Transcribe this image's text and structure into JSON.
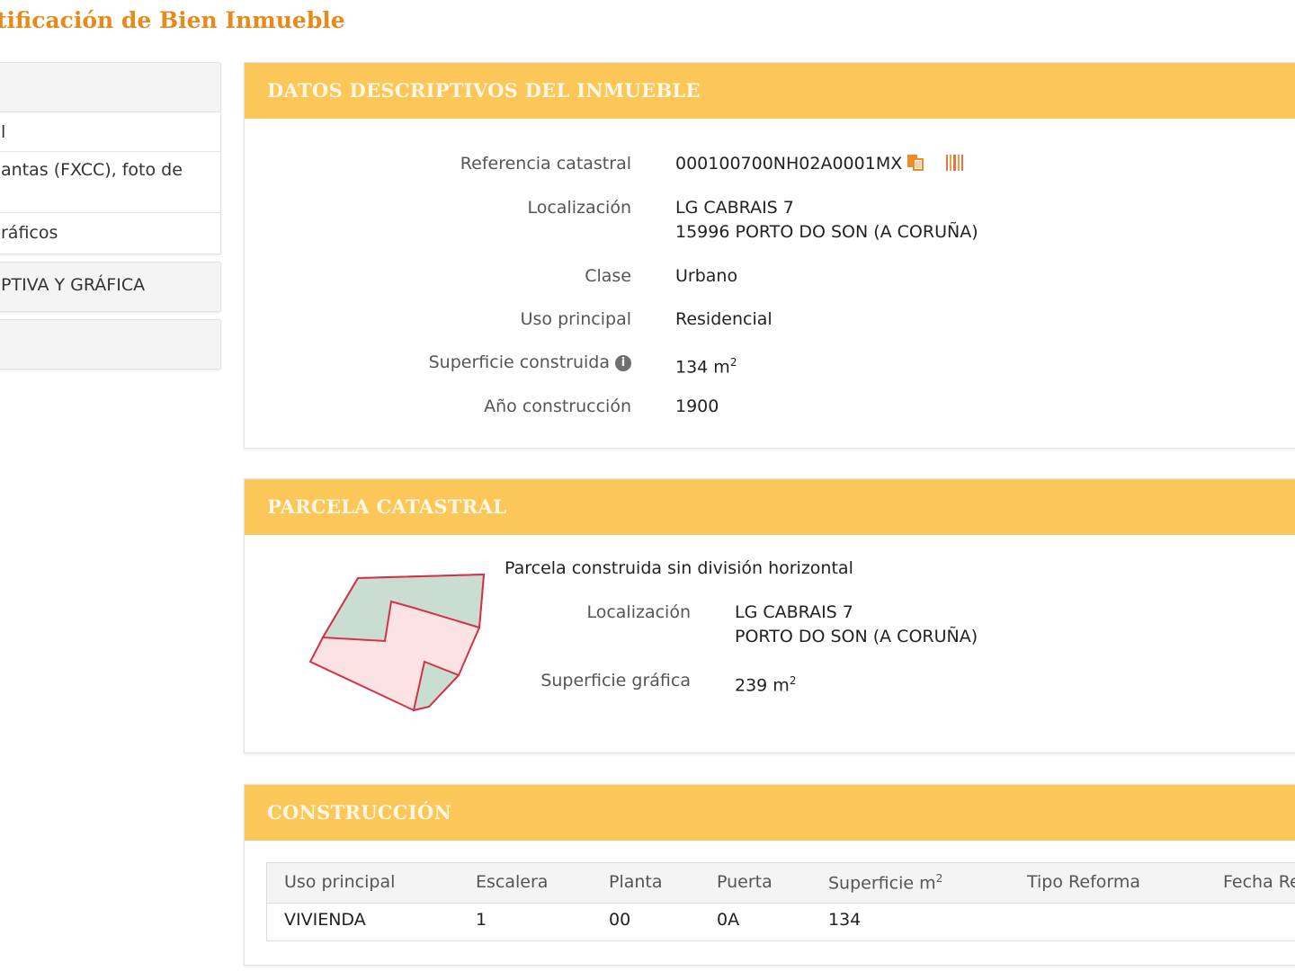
{
  "page": {
    "title": "tificación de Bien Inmueble"
  },
  "sidebar": {
    "items": [
      {
        "label": "l"
      },
      {
        "label": "antas (FXCC), foto de"
      },
      {
        "label": "ráficos"
      }
    ],
    "section": "PTIVA Y GRÁFICA"
  },
  "datos": {
    "header": "DATOS DESCRIPTIVOS DEL INMUEBLE",
    "ref_label": "Referencia catastral",
    "ref_value": "000100700NH02A0001MX",
    "loc_label": "Localización",
    "loc_line1": "LG CABRAIS 7",
    "loc_line2": "15996 PORTO DO SON (A CORUÑA)",
    "clase_label": "Clase",
    "clase_value": "Urbano",
    "uso_label": "Uso principal",
    "uso_value": "Residencial",
    "sup_label": "Superficie construida",
    "sup_value": "134 m",
    "sup_sup": "2",
    "info_glyph": "i",
    "anio_label": "Año construcción",
    "anio_value": "1900"
  },
  "parcela": {
    "header": "PARCELA CATASTRAL",
    "subtitle": "Parcela construida sin división horizontal",
    "loc_label": "Localización",
    "loc_line1": "LG CABRAIS 7",
    "loc_line2": "PORTO DO SON (A CORUÑA)",
    "sup_label": "Superficie gráfica",
    "sup_value": "239 m",
    "sup_sup": "2"
  },
  "construccion": {
    "header": "CONSTRUCCIÓN",
    "columns": [
      "Uso principal",
      "Escalera",
      "Planta",
      "Puerta",
      "Superficie m",
      "Tipo Reforma",
      "Fecha Re"
    ],
    "sup_col_sup": "2",
    "rows": [
      [
        "VIVIENDA",
        "1",
        "00",
        "0A",
        "134",
        "",
        ""
      ]
    ]
  },
  "colors": {
    "accent_orange": "#e88a1a",
    "panel_header": "#fbc758",
    "plot_fill_pink": "#fbe3e3",
    "plot_fill_green": "#c9ddd0",
    "plot_stroke": "#d0334a"
  },
  "icons": [
    "copy-icon",
    "barcode-icon",
    "info-icon"
  ]
}
